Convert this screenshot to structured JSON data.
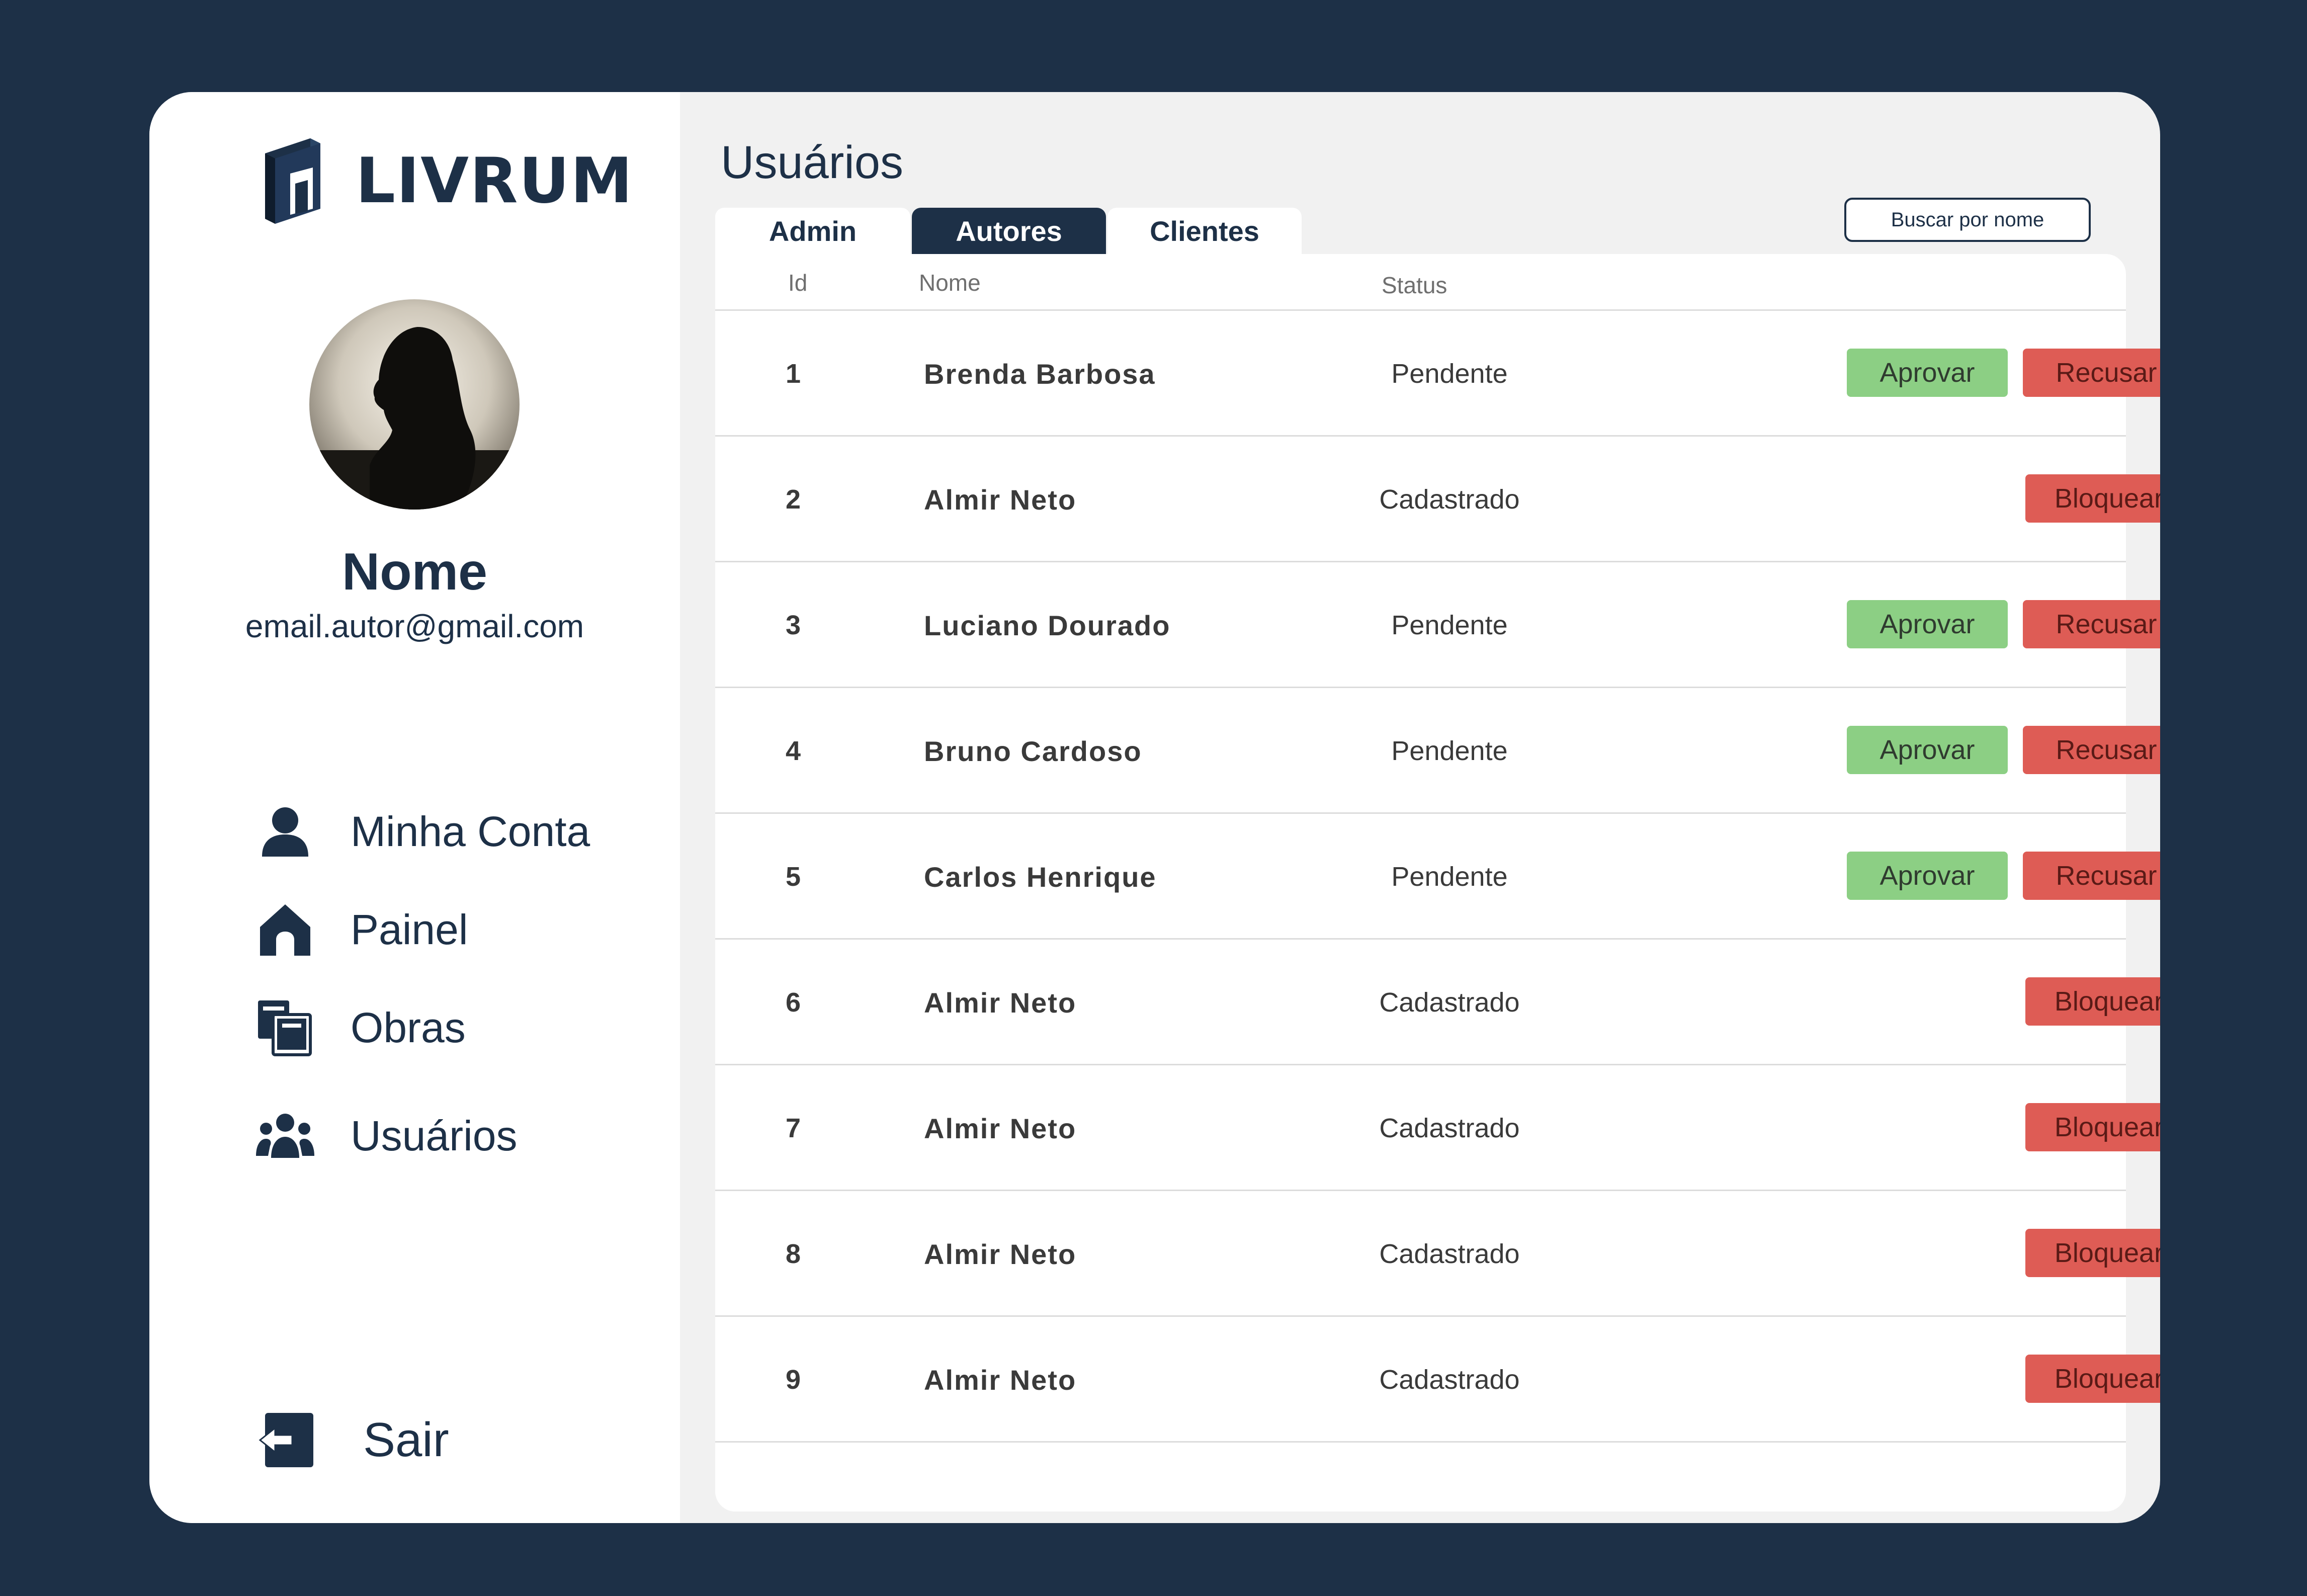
{
  "brand": {
    "name": "LIVRUM"
  },
  "profile": {
    "name": "Nome",
    "email": "email.autor@gmail.com"
  },
  "nav": {
    "items": [
      {
        "label": "Minha Conta",
        "icon": "user-icon"
      },
      {
        "label": "Painel",
        "icon": "home-icon"
      },
      {
        "label": "Obras",
        "icon": "books-icon"
      },
      {
        "label": "Usuários",
        "icon": "users-group-icon"
      }
    ],
    "logout": {
      "label": "Sair",
      "icon": "logout-icon"
    }
  },
  "main": {
    "title": "Usuários",
    "tabs": [
      {
        "label": "Admin",
        "active": false
      },
      {
        "label": "Autores",
        "active": true
      },
      {
        "label": "Clientes",
        "active": false
      }
    ],
    "search": {
      "placeholder": "Buscar por nome"
    },
    "table": {
      "headers": {
        "id": "Id",
        "name": "Nome",
        "status": "Status"
      },
      "rows": [
        {
          "id": "1",
          "name": "Brenda Barbosa",
          "status": "Pendente",
          "actions": [
            "Aprovar",
            "Recusar"
          ]
        },
        {
          "id": "2",
          "name": "Almir Neto",
          "status": "Cadastrado",
          "actions": [
            "Bloquear"
          ]
        },
        {
          "id": "3",
          "name": "Luciano Dourado",
          "status": "Pendente",
          "actions": [
            "Aprovar",
            "Recusar"
          ]
        },
        {
          "id": "4",
          "name": "Bruno Cardoso",
          "status": "Pendente",
          "actions": [
            "Aprovar",
            "Recusar"
          ]
        },
        {
          "id": "5",
          "name": "Carlos Henrique",
          "status": "Pendente",
          "actions": [
            "Aprovar",
            "Recusar"
          ]
        },
        {
          "id": "6",
          "name": "Almir Neto",
          "status": "Cadastrado",
          "actions": [
            "Bloquear"
          ]
        },
        {
          "id": "7",
          "name": "Almir Neto",
          "status": "Cadastrado",
          "actions": [
            "Bloquear"
          ]
        },
        {
          "id": "8",
          "name": "Almir Neto",
          "status": "Cadastrado",
          "actions": [
            "Bloquear"
          ]
        },
        {
          "id": "9",
          "name": "Almir Neto",
          "status": "Cadastrado",
          "actions": [
            "Bloquear"
          ]
        }
      ]
    }
  },
  "colors": {
    "background": "#1d3047",
    "primary": "#1d3047",
    "approve": "#8ccf84",
    "reject": "#de5c55"
  }
}
